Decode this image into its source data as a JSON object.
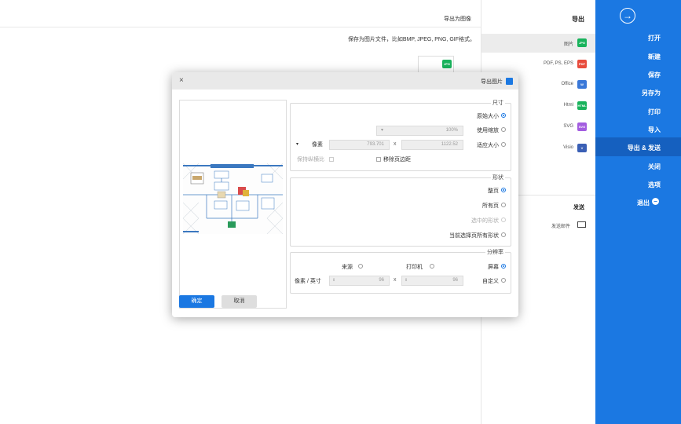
{
  "sidebar": {
    "back_icon": "arrow-right-circle-icon",
    "items": [
      "打开",
      "新建",
      "保存",
      "另存为",
      "打印",
      "导入",
      "导出 & 发送",
      "关闭",
      "选项",
      "退出"
    ],
    "active_index": 6,
    "exit_icon": "minus-circle-icon"
  },
  "export_panel": {
    "export_title": "导出",
    "formats": [
      {
        "label": "图片",
        "icon_text": "JPG",
        "color": "#19b35c"
      },
      {
        "label": "PDF, PS, EPS",
        "icon_text": "PDF",
        "color": "#e84b3c"
      },
      {
        "label": "Office",
        "icon_text": "W",
        "color": "#3a78d8"
      },
      {
        "label": "Html",
        "icon_text": "HTML",
        "color": "#19b35c"
      },
      {
        "label": "SVG",
        "icon_text": "SVG",
        "color": "#a35de0"
      },
      {
        "label": "Visio",
        "icon_text": "V",
        "color": "#3a5fb5"
      }
    ],
    "selected_index": 0,
    "send_title": "发送",
    "send_email_label": "发送邮件"
  },
  "main": {
    "header": "导出为图像",
    "description": "保存为图片文件，比如BMP, JPEG, PNG, GIF格式。",
    "thumb_icon_text": "JPG"
  },
  "dialog": {
    "title": "导出图片",
    "close_icon": "close-icon",
    "size": {
      "legend": "尺寸",
      "original_label": "原始大小",
      "scale_label": "使用缩放",
      "scale_value": "100%",
      "fit_label": "适应大小",
      "width_value": "1122.52",
      "times": "x",
      "height_value": "793.701",
      "unit": "像素",
      "remove_margin_label": "移除页边距",
      "keep_ratio_label": "保持纵横比"
    },
    "shape": {
      "legend": "形状",
      "options": [
        "整页",
        "所有页",
        "选中的形状",
        "当前选择页所有形状"
      ],
      "selected_index": 0,
      "disabled_index": 2
    },
    "resolution": {
      "legend": "分辨率",
      "screen_label": "屏幕",
      "printer_label": "打印机",
      "source_label": "来源",
      "custom_label": "自定义",
      "x_value": "96",
      "times": "x",
      "y_value": "96",
      "unit": "像素 / 英寸"
    },
    "ok_label": "确定",
    "cancel_label": "取消"
  }
}
